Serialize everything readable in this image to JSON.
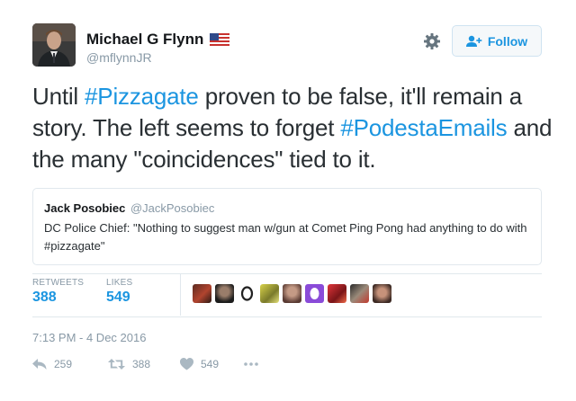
{
  "profile": {
    "name": "Michael G Flynn",
    "handle": "@mflynnJR",
    "flag_icon": "us-flag-icon"
  },
  "header": {
    "follow_label": "Follow",
    "settings_icon": "gear-icon"
  },
  "tweet": {
    "segments": [
      "Until ",
      "#Pizzagate",
      " proven to be false, it'll remain a story. The left seems to forget ",
      "#PodestaEmails",
      " and the many \"coincidences\" tied to it."
    ]
  },
  "quote": {
    "author_name": "Jack Posobiec",
    "author_handle": "@JackPosobiec",
    "text": "DC Police Chief: \"Nothing to suggest man w/gun at Comet Ping Pong had anything to do with #pizzagate\""
  },
  "stats": {
    "retweets_label": "RETWEETS",
    "retweets_value": "388",
    "likes_label": "LIKES",
    "likes_value": "549"
  },
  "timestamp": "7:13 PM - 4 Dec 2016",
  "actions": {
    "reply_count": "259",
    "retweet_count": "388",
    "like_count": "549"
  },
  "colors": {
    "link": "#1b95e0",
    "muted": "#8899a6",
    "text": "#292f33",
    "border": "#e1e8ed"
  }
}
